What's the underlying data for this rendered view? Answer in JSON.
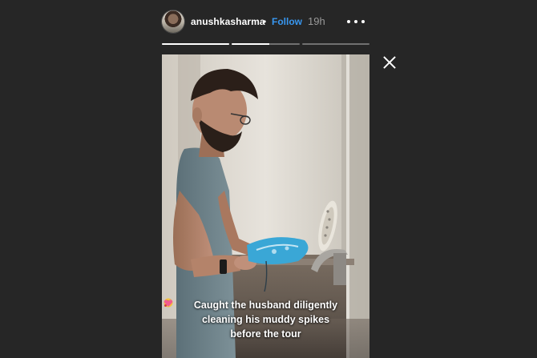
{
  "header": {
    "username": "anushkasharma",
    "separator": "•",
    "follow_label": "Follow",
    "time": "19h",
    "more_icon": "more-horizontal-icon",
    "avatar_icon": "profile-avatar"
  },
  "progress": {
    "segments": 3,
    "current_segment": 1,
    "current_fill": 0.55
  },
  "controls": {
    "close_icon": "close-icon"
  },
  "story": {
    "caption_line1": "Caught the husband diligently",
    "caption_line2": "cleaning his muddy spikes",
    "caption_line3": "before the tour",
    "caption_emojis": [
      "nerd-face-emoji",
      "cricket-emoji",
      "two-hearts-emoji"
    ]
  },
  "colors": {
    "background": "#262626",
    "follow": "#3897f0",
    "text": "#ffffff",
    "time": "#9a9a9a"
  }
}
